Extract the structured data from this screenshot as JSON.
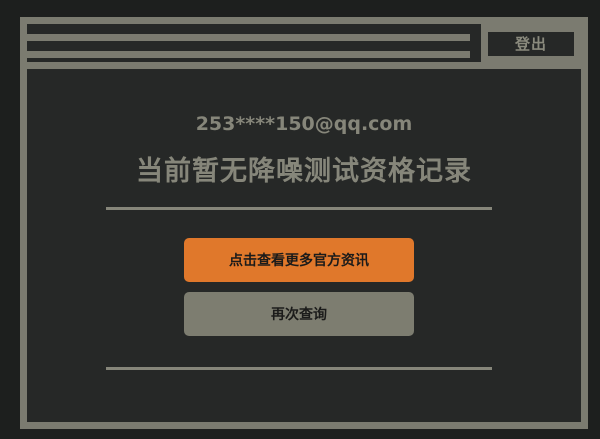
{
  "header": {
    "logout_label": "登出"
  },
  "main": {
    "email": "253****150@qq.com",
    "headline": "当前暂无降噪测试资格记录",
    "primary_button_label": "点击查看更多官方资讯",
    "secondary_button_label": "再次查询"
  },
  "colors": {
    "accent": "#e0782b",
    "frame": "#7b7b70",
    "background": "#1d1f1e"
  }
}
